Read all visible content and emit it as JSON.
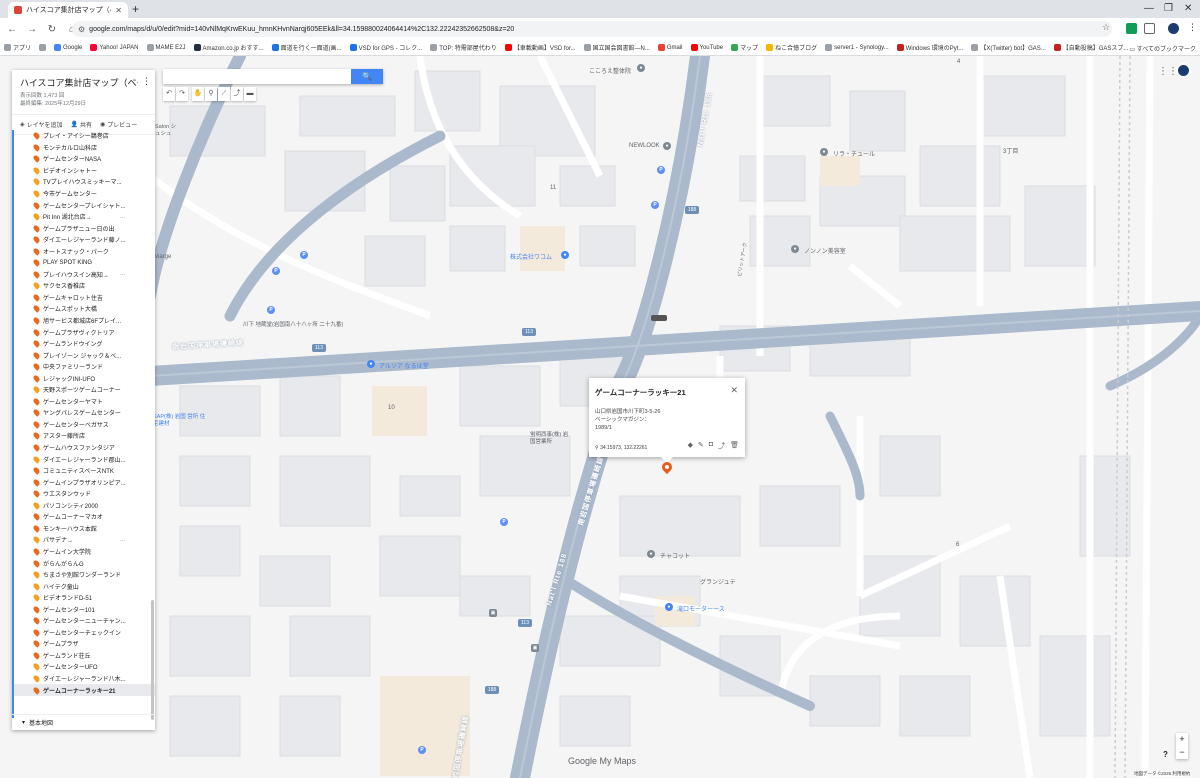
{
  "browser": {
    "tab_title": "ハイスコア集計店マップ（ベーシックマ",
    "url": "google.com/maps/d/u/0/edit?mid=140vNlMqKrwEKuu_hmnKHvnNarqj605EEk&ll=34.159880024064414%2C132.22242352662508&z=20",
    "bookmarks": [
      "アプリ",
      "Google",
      "Yahoo! JAPAN",
      "MAME E2J",
      "Amazon.co.jp おすす...",
      "面道を行く一面道(画...",
      "VSD for GPS - コレク...",
      "TOP: 特需部屋代わり",
      "【車載動画】VSD for...",
      "国立国会図書館―N...",
      "Gmail",
      "YouTube",
      "マップ",
      "ねこ合憶ブログ",
      "server1 - Synology...",
      "Windows 環境のPyt...",
      "【X(Twitter) bot】GAS...",
      "【自動投稿】GASスブ..."
    ],
    "all_bookmarks": "すべてのブックマーク"
  },
  "panel": {
    "title": "ハイスコア集計店マップ（ベーシックマガジン）",
    "views": "表示回数 1,473 回",
    "edited": "最終編集: 2025年12月29日",
    "add_layer": "レイヤを追加",
    "share": "共有",
    "preview": "プレビュー",
    "basemap": "基本地図",
    "items": [
      {
        "label": "プレイ・アイシー鵜巻店",
        "color": "red"
      },
      {
        "label": "モンテカルロ山科店",
        "color": "red"
      },
      {
        "label": "ゲームセンターNASA",
        "color": "red"
      },
      {
        "label": "ビデオインシャトー",
        "color": "orange"
      },
      {
        "label": "TVプレイハウスミッキーマ...",
        "color": "orange"
      },
      {
        "label": "今市ゲームセンター",
        "color": "orange"
      },
      {
        "label": "ゲームセンタープレイシャト...",
        "color": "red"
      },
      {
        "label": "Pit Inn 湖北台店→",
        "color": "orange",
        "dots": true
      },
      {
        "label": "ゲームプラザニュー日の出",
        "color": "red"
      },
      {
        "label": "ダイエーレジャーランド藤ノ...",
        "color": "red"
      },
      {
        "label": "オートスナック・パーク",
        "color": "red"
      },
      {
        "label": "PLAY SPOT KING",
        "color": "red"
      },
      {
        "label": "プレイハウスイン高知→",
        "color": "red",
        "dots": true
      },
      {
        "label": "サクセス香椎店",
        "color": "orange"
      },
      {
        "label": "ゲームキャロット住吉",
        "color": "red"
      },
      {
        "label": "ゲームスポット大橋",
        "color": "red"
      },
      {
        "label": "旭サービス都城店6Fプレイ...",
        "color": "red"
      },
      {
        "label": "ゲームプラザヴィクトリア",
        "color": "red"
      },
      {
        "label": "ゲームランドウイング",
        "color": "red"
      },
      {
        "label": "プレイゾーン ジャック＆ベ...",
        "color": "red"
      },
      {
        "label": "中央ファミリーランド",
        "color": "red"
      },
      {
        "label": "レジャックINI-UFO",
        "color": "red"
      },
      {
        "label": "天野スポーツゲームコーナー",
        "color": "orange"
      },
      {
        "label": "ゲームセンターヤマト",
        "color": "red"
      },
      {
        "label": "ヤングパレスゲームセンター",
        "color": "red"
      },
      {
        "label": "ゲームセンターベガサス",
        "color": "red"
      },
      {
        "label": "アスター藤所店",
        "color": "red"
      },
      {
        "label": "ゲームハウスファンタジア",
        "color": "red"
      },
      {
        "label": "ダイエーレジャーランド郡山...",
        "color": "orange"
      },
      {
        "label": "コミュニティスペースNTK",
        "color": "red"
      },
      {
        "label": "ゲームインプラザオリンピア...",
        "color": "red"
      },
      {
        "label": "ウエスタンウッド",
        "color": "red"
      },
      {
        "label": "パソコンシティ2000",
        "color": "orange"
      },
      {
        "label": "ゲームコーナーマカオ",
        "color": "red"
      },
      {
        "label": "モンキーハウス本館",
        "color": "red"
      },
      {
        "label": "パサデナ→",
        "color": "orange",
        "dots": true
      },
      {
        "label": "ゲームイン大学院",
        "color": "red"
      },
      {
        "label": "がらんがらんG",
        "color": "red"
      },
      {
        "label": "ちまさや別館ワンダーランド",
        "color": "orange"
      },
      {
        "label": "ハイテク童山",
        "color": "orange"
      },
      {
        "label": "ビデオランドD-51",
        "color": "orange"
      },
      {
        "label": "ゲームセンター101",
        "color": "red"
      },
      {
        "label": "ゲームセンターニューチャン...",
        "color": "red"
      },
      {
        "label": "ゲームセンターチェックイン",
        "color": "red"
      },
      {
        "label": "ゲームプラザ",
        "color": "red"
      },
      {
        "label": "ゲームランド荘丘",
        "color": "red"
      },
      {
        "label": "ゲームセンターUFO",
        "color": "orange"
      },
      {
        "label": "ダイエーレジャーランド八木...",
        "color": "orange"
      },
      {
        "label": "ゲームコーナーラッキー21",
        "color": "red",
        "selected": true
      }
    ]
  },
  "card": {
    "title": "ゲームコーナーラッキー21",
    "address": "山口県岩国市川下町3-5-26",
    "magazine": "ベーシックマガジン：",
    "date": "1989/1",
    "coords": "34.15973, 132.22261"
  },
  "map_labels": {
    "cocoroe": "こころえ整体院",
    "newlook": "NEWLOOK",
    "lila": "リラ・チュール",
    "block3": "3丁目",
    "block11": "11",
    "wakomu": "株式会社ワコム",
    "nonnon": "ノンノン美容室",
    "kawashita": "川下 地蔵堂(岩国南八十八ヶ所 二十九番)",
    "alsoa": "アルソア なるほ堂",
    "block10": "10",
    "minami": "南岩国停車場磯崎線",
    "route188": "188",
    "route113": "113",
    "chacotto": "チャコット",
    "granjute": "グランジュテ",
    "takiguchi": "滝口モーターース",
    "block6": "6",
    "block4": "4",
    "nat188": "Nat'l Rte 188",
    "salon": "Salon シュシュ",
    "viarge": "viarge",
    "suefuji": "蛍明西事(株) 岩国営業所",
    "kap": "KAP(株) 岩国 営所 住宅建材",
    "pilot": "ピリットアーク"
  },
  "footer": {
    "brand": "Google My Maps",
    "copyright": "地図データ ©2026   利用規約",
    "zoom_in": "+",
    "zoom_out": "−",
    "help": "?"
  }
}
